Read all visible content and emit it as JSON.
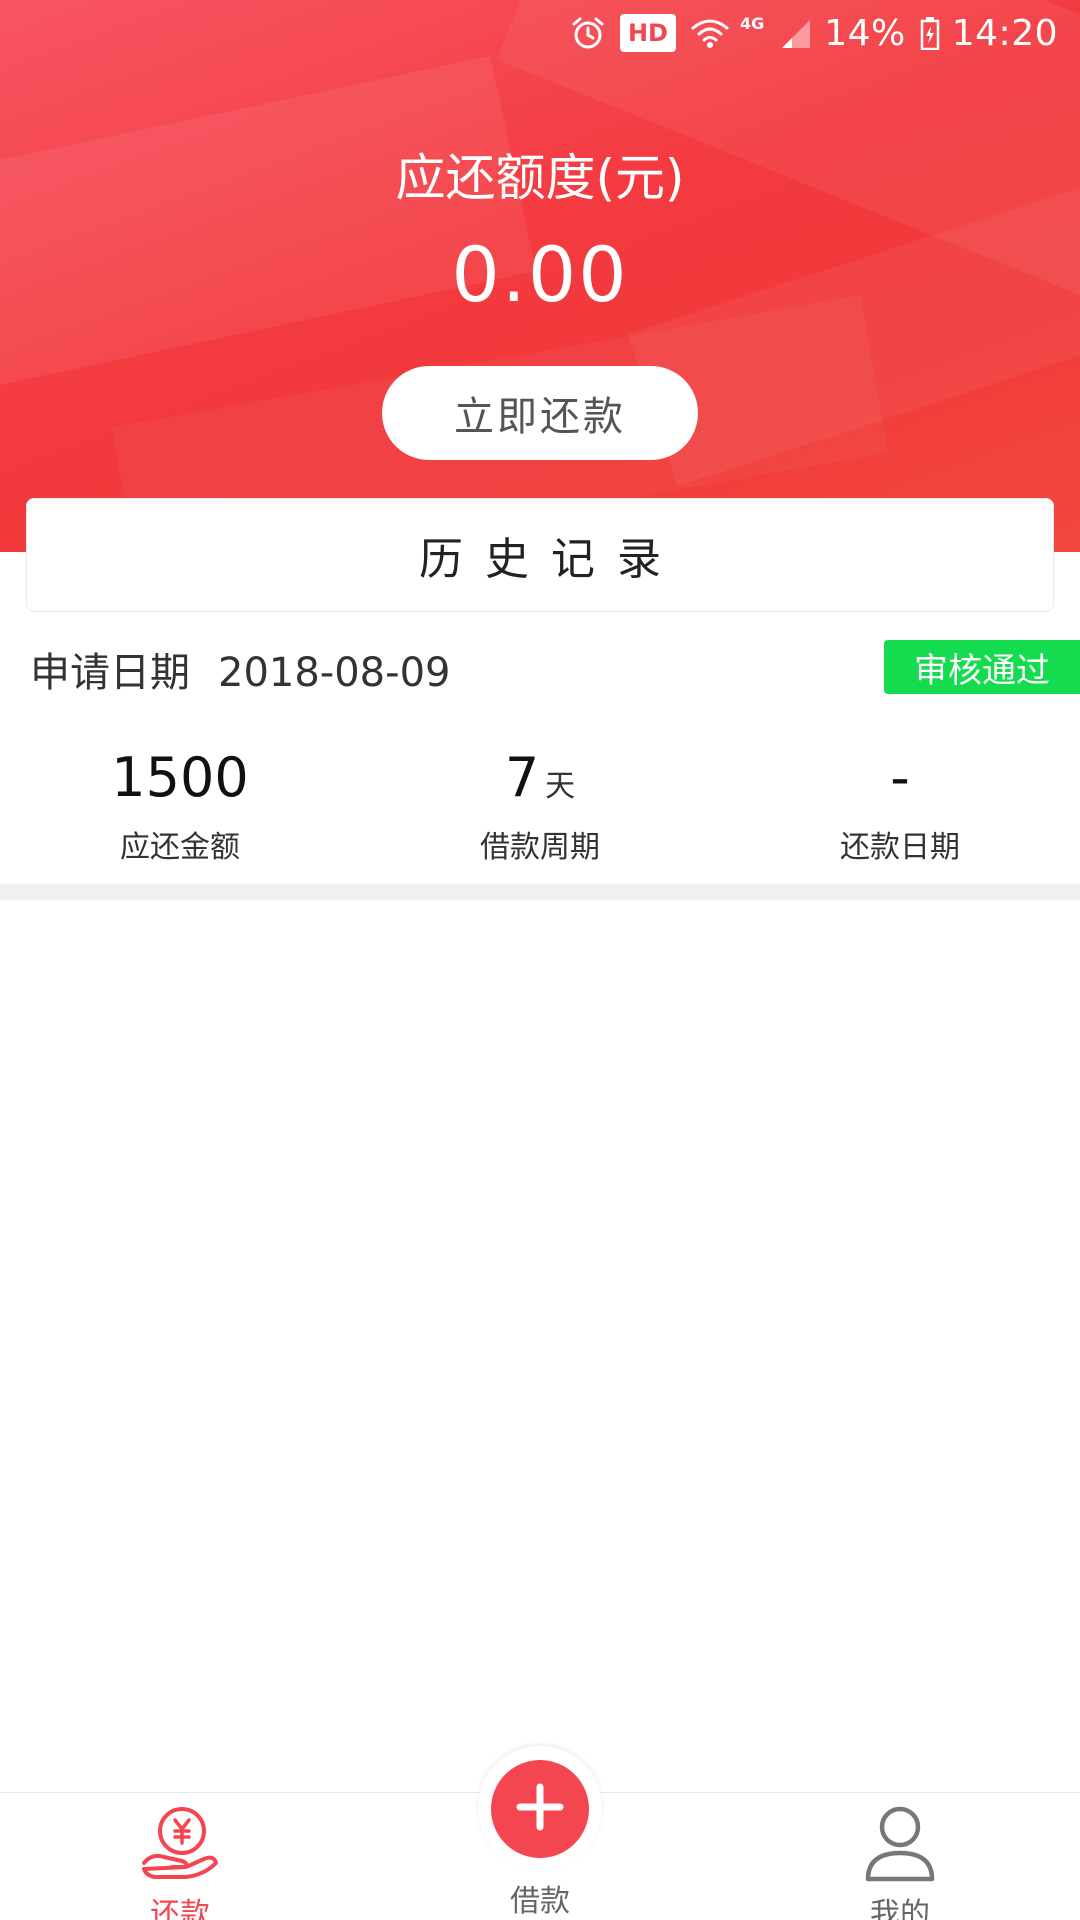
{
  "status_bar": {
    "hd": "HD",
    "network": "4G",
    "battery": "14%",
    "time": "14:20"
  },
  "header": {
    "amount_label": "应还额度(元)",
    "amount_value": "0.00",
    "repay_button": "立即还款"
  },
  "history": {
    "title": "历史记录"
  },
  "record": {
    "date_label": "申请日期",
    "date_value": "2018-08-09",
    "status": "审核通过",
    "stats": [
      {
        "value": "1500",
        "unit": "",
        "label": "应还金额"
      },
      {
        "value": "7",
        "unit": "天",
        "label": "借款周期"
      },
      {
        "value": "-",
        "unit": "",
        "label": "还款日期"
      }
    ]
  },
  "bottom_nav": {
    "left_label": "还款",
    "center_label": "借款",
    "right_label": "我的"
  },
  "colors": {
    "brand_red": "#f34651",
    "status_green": "#14dc4e"
  }
}
